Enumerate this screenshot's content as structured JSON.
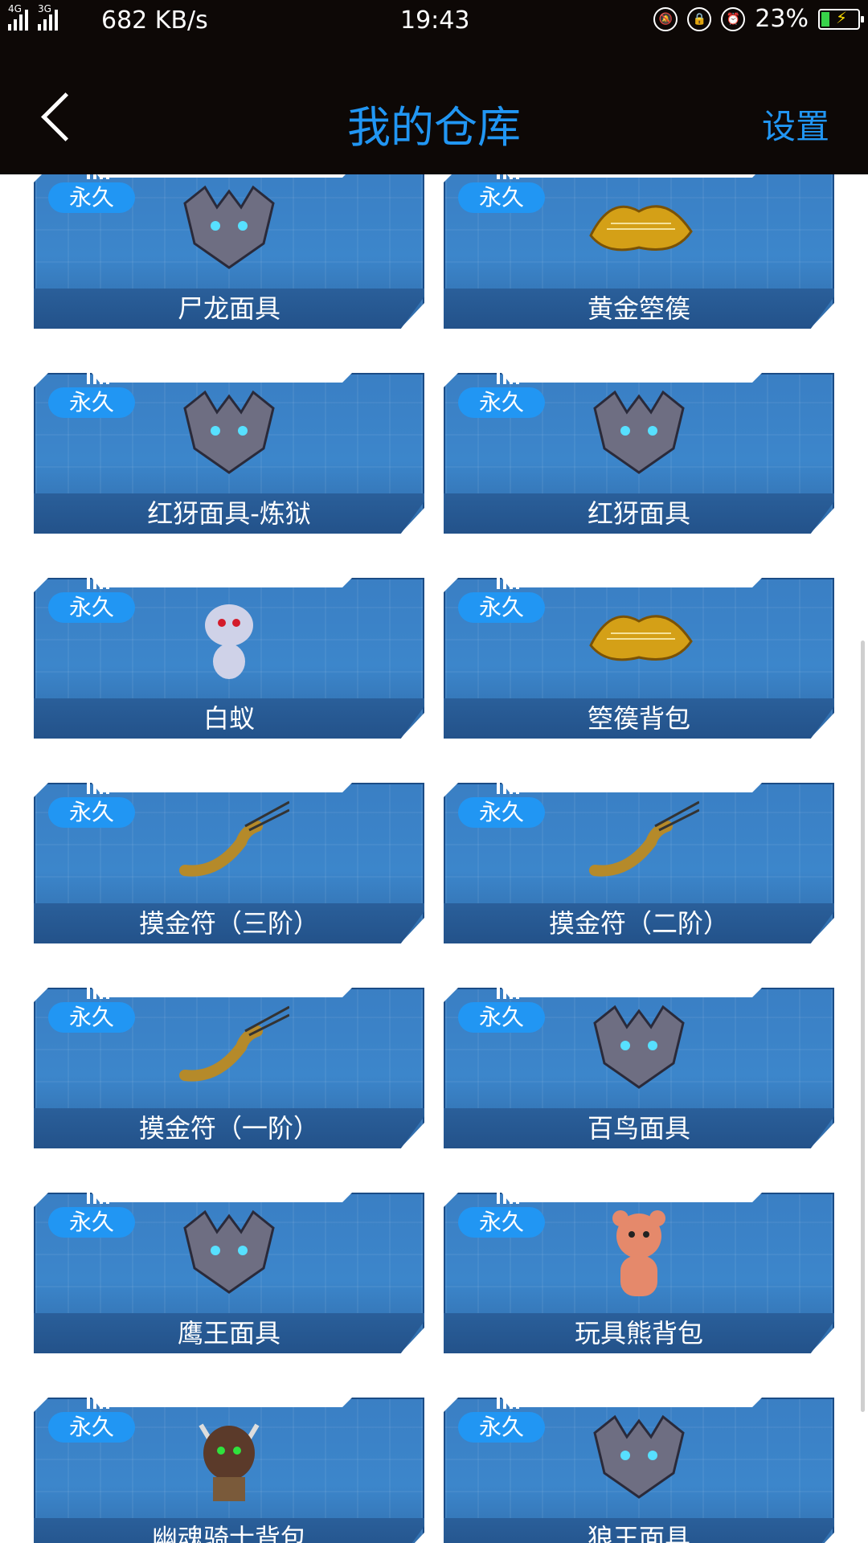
{
  "status_bar": {
    "network_a": "4G",
    "network_b": "3G",
    "speed": "682 KB/s",
    "time": "19:43",
    "battery": "23%",
    "battery_level": 0.23,
    "icons": [
      "mute-icon",
      "lock-rotation-icon",
      "alarm-icon"
    ]
  },
  "nav": {
    "title": "我的仓库",
    "settings_label": "设置",
    "back_icon": "chevron-left-icon"
  },
  "items": [
    {
      "name": "尸龙面具",
      "badge": "永久",
      "icon": "mask-icon"
    },
    {
      "name": "黄金箜篌",
      "badge": "永久",
      "icon": "harp-icon"
    },
    {
      "name": "红犽面具-炼狱",
      "badge": "永久",
      "icon": "mask-icon"
    },
    {
      "name": "红犽面具",
      "badge": "永久",
      "icon": "mask-icon"
    },
    {
      "name": "白蚁",
      "badge": "永久",
      "icon": "pet-icon"
    },
    {
      "name": "箜篌背包",
      "badge": "永久",
      "icon": "harp-icon"
    },
    {
      "name": "摸金符（三阶）",
      "badge": "永久",
      "icon": "claw-pendant-icon"
    },
    {
      "name": "摸金符（二阶）",
      "badge": "永久",
      "icon": "claw-pendant-icon"
    },
    {
      "name": "摸金符（一阶）",
      "badge": "永久",
      "icon": "claw-pendant-icon"
    },
    {
      "name": "百鸟面具",
      "badge": "永久",
      "icon": "mask-icon"
    },
    {
      "name": "鹰王面具",
      "badge": "永久",
      "icon": "mask-icon"
    },
    {
      "name": "玩具熊背包",
      "badge": "永久",
      "icon": "teddy-bear-icon"
    },
    {
      "name": "幽魂骑士背包",
      "badge": "永久",
      "icon": "knight-icon"
    },
    {
      "name": "狼王面具",
      "badge": "永久",
      "icon": "mask-icon"
    }
  ]
}
